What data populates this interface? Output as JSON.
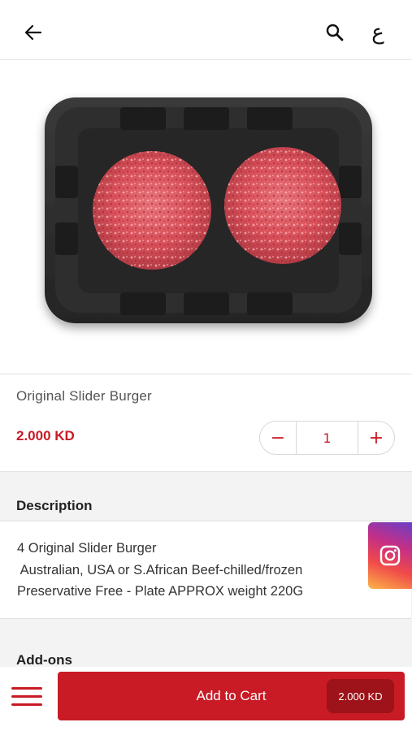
{
  "header": {
    "back_icon": "arrow-left-icon",
    "search_icon": "search-icon",
    "language_toggle": "ع"
  },
  "product": {
    "image_icon": "burger-patties-tray-image",
    "name": "Original Slider Burger",
    "price": "2.000 KD",
    "quantity": "1",
    "decrement_label": "−",
    "increment_label": "+"
  },
  "description": {
    "title": "Description",
    "lines": [
      "4 Original Slider Burger",
      " Australian, USA or S.African Beef-chilled/frozen",
      "Preservative Free - Plate APPROX weight 220G"
    ]
  },
  "addons": {
    "title": "Add-ons"
  },
  "social": {
    "icon": "instagram-icon"
  },
  "footer": {
    "menu_icon": "hamburger-menu-icon",
    "add_to_cart_label": "Add to Cart",
    "cart_price": "2.000 KD"
  },
  "colors": {
    "accent": "#c81b25",
    "accent_dark": "#9e1219",
    "section_bg": "#f3f3f3"
  }
}
